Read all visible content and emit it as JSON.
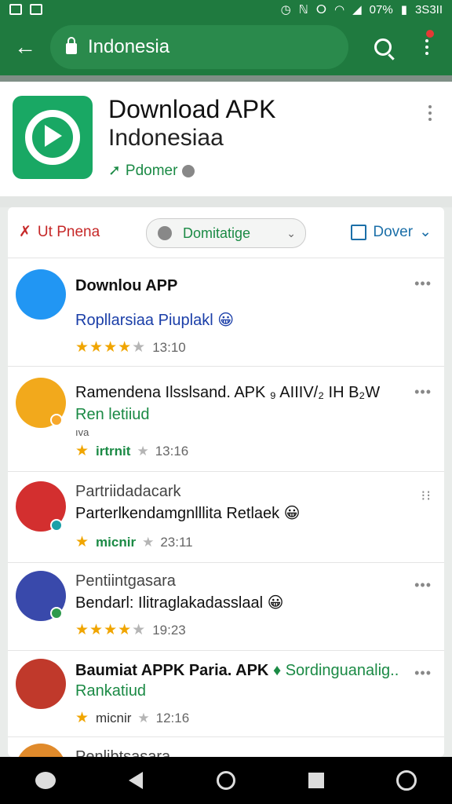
{
  "status_bar": {
    "battery": "07%",
    "time": "3S3II"
  },
  "url_bar": {
    "text": "Indonesia"
  },
  "app_header": {
    "title": "Download APK",
    "subtitle": "Indonesiaa",
    "developer": "Pdomer"
  },
  "filters": {
    "left": "Ut Pnena",
    "middle": "Domitatige",
    "right": "Dover"
  },
  "items": [
    {
      "title": "Downlou APP",
      "subtitle": "Ropllarsiaa Piuplakl 😀",
      "subtitle_color": "#1a3ea8",
      "extra": "",
      "rating_label": "",
      "stars_filled": 4,
      "time": "13:10"
    },
    {
      "title": "Ramendena Ilsslsand. APK ₉ AIIIV/₂ IH B₂W",
      "subtitle": "Ren letiiud",
      "subtitle_color": "#1b8a45",
      "extra": "ıva",
      "rating_label": "irtrnit",
      "stars_filled": 1,
      "time": "13:16"
    },
    {
      "title": "Partriidadacark",
      "subtitle": "Parterlkendamgnlllita Retlaek 😀",
      "subtitle_color": "#111",
      "extra": "",
      "rating_label": "micnir",
      "stars_filled": 1,
      "time": "23:11"
    },
    {
      "title": "Pentiintgasara",
      "subtitle": "Bendarl: Ilitraglakadasslaal 😀",
      "subtitle_color": "#111",
      "extra": "",
      "rating_label": "",
      "stars_filled": 4,
      "time": "19:23"
    },
    {
      "title": "Baumiat APPK Paria. APK",
      "title_green": "♦ Sordinguanalig..",
      "subtitle": "Rankatiud",
      "subtitle_color": "#1b8a45",
      "extra": "",
      "rating_label": "micnir",
      "stars_filled": 1,
      "time": "12:16"
    },
    {
      "title": "Penlibtsasara"
    }
  ]
}
